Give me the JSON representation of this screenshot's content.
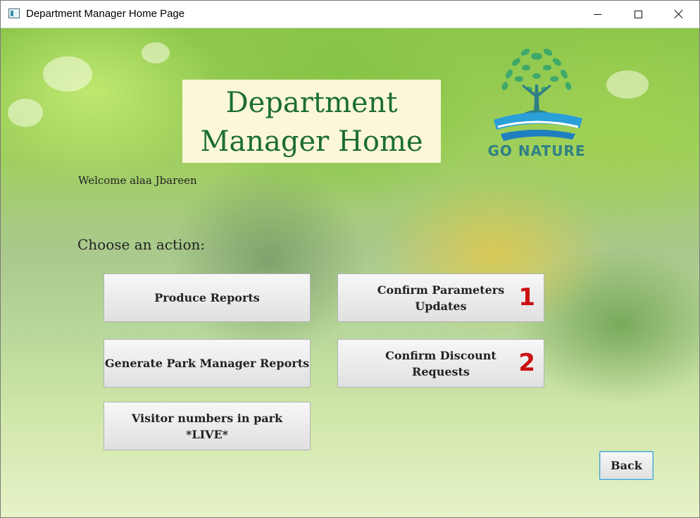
{
  "window": {
    "title": "Department Manager Home Page"
  },
  "header": {
    "title_line1": "Department",
    "title_line2": "Manager Home"
  },
  "logo": {
    "text": "GO NATURE"
  },
  "welcome_text": "Welcome alaa Jbareen",
  "choose_text": "Choose an action:",
  "actions": {
    "produce_reports": "Produce Reports",
    "confirm_parameters": "Confirm Parameters\nUpdates",
    "confirm_parameters_count": "1",
    "generate_park_reports": "Generate Park Manager Reports",
    "confirm_discount": "Confirm Discount\nRequests",
    "confirm_discount_count": "2",
    "visitor_numbers": "Visitor numbers in park\n*LIVE*"
  },
  "back_label": "Back",
  "colors": {
    "title_text": "#1b6e2f",
    "title_box": "#fdf7d9",
    "badge": "#cc1111",
    "logo_text": "#2f7f86"
  }
}
